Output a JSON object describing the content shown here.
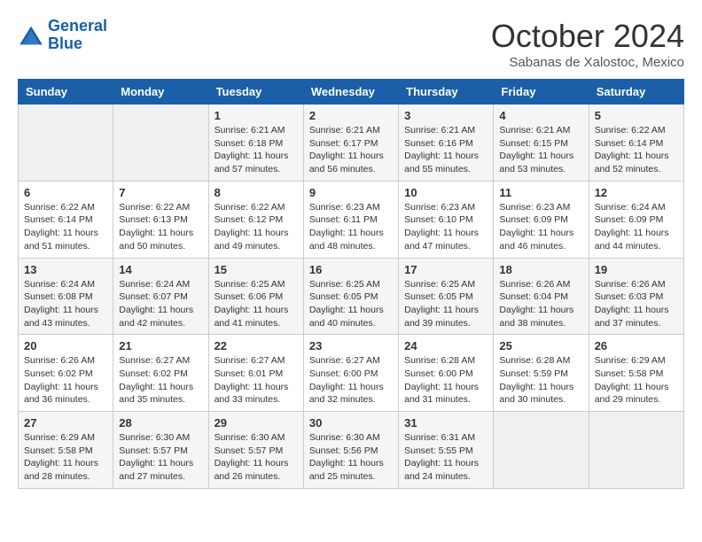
{
  "header": {
    "logo": {
      "line1": "General",
      "line2": "Blue"
    },
    "title": "October 2024",
    "location": "Sabanas de Xalostoc, Mexico"
  },
  "weekdays": [
    "Sunday",
    "Monday",
    "Tuesday",
    "Wednesday",
    "Thursday",
    "Friday",
    "Saturday"
  ],
  "weeks": [
    [
      {
        "day": "",
        "info": ""
      },
      {
        "day": "",
        "info": ""
      },
      {
        "day": "1",
        "info": "Sunrise: 6:21 AM\nSunset: 6:18 PM\nDaylight: 11 hours and 57 minutes."
      },
      {
        "day": "2",
        "info": "Sunrise: 6:21 AM\nSunset: 6:17 PM\nDaylight: 11 hours and 56 minutes."
      },
      {
        "day": "3",
        "info": "Sunrise: 6:21 AM\nSunset: 6:16 PM\nDaylight: 11 hours and 55 minutes."
      },
      {
        "day": "4",
        "info": "Sunrise: 6:21 AM\nSunset: 6:15 PM\nDaylight: 11 hours and 53 minutes."
      },
      {
        "day": "5",
        "info": "Sunrise: 6:22 AM\nSunset: 6:14 PM\nDaylight: 11 hours and 52 minutes."
      }
    ],
    [
      {
        "day": "6",
        "info": "Sunrise: 6:22 AM\nSunset: 6:14 PM\nDaylight: 11 hours and 51 minutes."
      },
      {
        "day": "7",
        "info": "Sunrise: 6:22 AM\nSunset: 6:13 PM\nDaylight: 11 hours and 50 minutes."
      },
      {
        "day": "8",
        "info": "Sunrise: 6:22 AM\nSunset: 6:12 PM\nDaylight: 11 hours and 49 minutes."
      },
      {
        "day": "9",
        "info": "Sunrise: 6:23 AM\nSunset: 6:11 PM\nDaylight: 11 hours and 48 minutes."
      },
      {
        "day": "10",
        "info": "Sunrise: 6:23 AM\nSunset: 6:10 PM\nDaylight: 11 hours and 47 minutes."
      },
      {
        "day": "11",
        "info": "Sunrise: 6:23 AM\nSunset: 6:09 PM\nDaylight: 11 hours and 46 minutes."
      },
      {
        "day": "12",
        "info": "Sunrise: 6:24 AM\nSunset: 6:09 PM\nDaylight: 11 hours and 44 minutes."
      }
    ],
    [
      {
        "day": "13",
        "info": "Sunrise: 6:24 AM\nSunset: 6:08 PM\nDaylight: 11 hours and 43 minutes."
      },
      {
        "day": "14",
        "info": "Sunrise: 6:24 AM\nSunset: 6:07 PM\nDaylight: 11 hours and 42 minutes."
      },
      {
        "day": "15",
        "info": "Sunrise: 6:25 AM\nSunset: 6:06 PM\nDaylight: 11 hours and 41 minutes."
      },
      {
        "day": "16",
        "info": "Sunrise: 6:25 AM\nSunset: 6:05 PM\nDaylight: 11 hours and 40 minutes."
      },
      {
        "day": "17",
        "info": "Sunrise: 6:25 AM\nSunset: 6:05 PM\nDaylight: 11 hours and 39 minutes."
      },
      {
        "day": "18",
        "info": "Sunrise: 6:26 AM\nSunset: 6:04 PM\nDaylight: 11 hours and 38 minutes."
      },
      {
        "day": "19",
        "info": "Sunrise: 6:26 AM\nSunset: 6:03 PM\nDaylight: 11 hours and 37 minutes."
      }
    ],
    [
      {
        "day": "20",
        "info": "Sunrise: 6:26 AM\nSunset: 6:02 PM\nDaylight: 11 hours and 36 minutes."
      },
      {
        "day": "21",
        "info": "Sunrise: 6:27 AM\nSunset: 6:02 PM\nDaylight: 11 hours and 35 minutes."
      },
      {
        "day": "22",
        "info": "Sunrise: 6:27 AM\nSunset: 6:01 PM\nDaylight: 11 hours and 33 minutes."
      },
      {
        "day": "23",
        "info": "Sunrise: 6:27 AM\nSunset: 6:00 PM\nDaylight: 11 hours and 32 minutes."
      },
      {
        "day": "24",
        "info": "Sunrise: 6:28 AM\nSunset: 6:00 PM\nDaylight: 11 hours and 31 minutes."
      },
      {
        "day": "25",
        "info": "Sunrise: 6:28 AM\nSunset: 5:59 PM\nDaylight: 11 hours and 30 minutes."
      },
      {
        "day": "26",
        "info": "Sunrise: 6:29 AM\nSunset: 5:58 PM\nDaylight: 11 hours and 29 minutes."
      }
    ],
    [
      {
        "day": "27",
        "info": "Sunrise: 6:29 AM\nSunset: 5:58 PM\nDaylight: 11 hours and 28 minutes."
      },
      {
        "day": "28",
        "info": "Sunrise: 6:30 AM\nSunset: 5:57 PM\nDaylight: 11 hours and 27 minutes."
      },
      {
        "day": "29",
        "info": "Sunrise: 6:30 AM\nSunset: 5:57 PM\nDaylight: 11 hours and 26 minutes."
      },
      {
        "day": "30",
        "info": "Sunrise: 6:30 AM\nSunset: 5:56 PM\nDaylight: 11 hours and 25 minutes."
      },
      {
        "day": "31",
        "info": "Sunrise: 6:31 AM\nSunset: 5:55 PM\nDaylight: 11 hours and 24 minutes."
      },
      {
        "day": "",
        "info": ""
      },
      {
        "day": "",
        "info": ""
      }
    ]
  ]
}
